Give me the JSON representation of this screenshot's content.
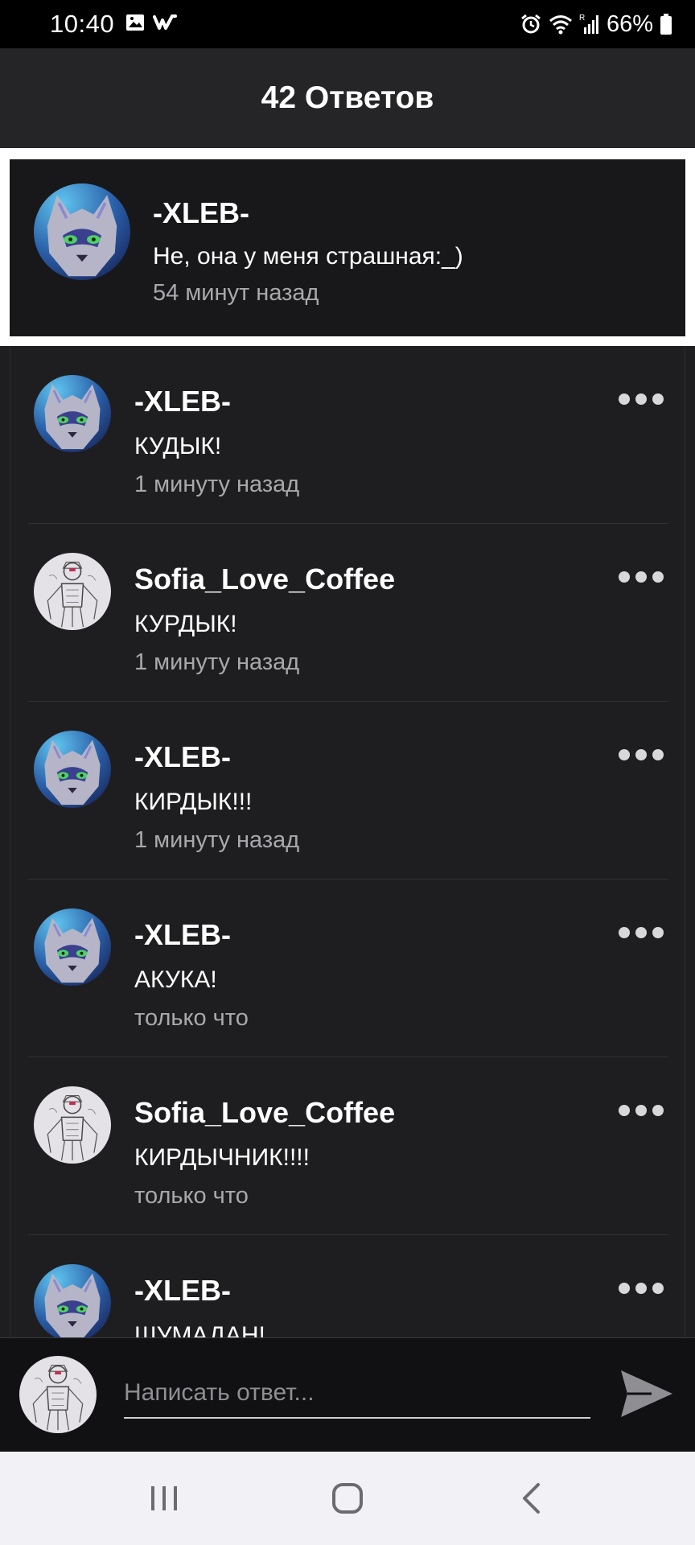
{
  "status_bar": {
    "time": "10:40",
    "battery": "66%",
    "left_icons": [
      "gallery-icon",
      "wattpad-icon"
    ],
    "right_icons": [
      "alarm-icon",
      "wifi-icon",
      "signal-icon",
      "battery-icon"
    ]
  },
  "header": {
    "title": "42 Ответов"
  },
  "parent_comment": {
    "author": "-XLEB-",
    "text": "Не, она у меня страшная:_)",
    "time": "54 минут назад",
    "avatar": "wolf-avatar"
  },
  "replies": [
    {
      "author": "-XLEB-",
      "text": "КУДЫК!",
      "time": "1 минуту назад",
      "avatar": "wolf-avatar"
    },
    {
      "author": "Sofia_Love_Coffee",
      "text": "КУРДЫК!",
      "time": "1 минуту назад",
      "avatar": "sketch-avatar"
    },
    {
      "author": "-XLEB-",
      "text": "КИРДЫК!!!",
      "time": "1 минуту назад",
      "avatar": "wolf-avatar"
    },
    {
      "author": "-XLEB-",
      "text": "АКУКА!",
      "time": "только что",
      "avatar": "wolf-avatar"
    },
    {
      "author": "Sofia_Love_Coffee",
      "text": "КИРДЫЧНИК!!!!",
      "time": "только что",
      "avatar": "sketch-avatar"
    },
    {
      "author": "-XLEB-",
      "text": "ШУМАДАН!",
      "time": "",
      "avatar": "wolf-avatar"
    }
  ],
  "composer": {
    "placeholder": "Написать ответ...",
    "avatar": "sketch-avatar",
    "send_icon": "send-icon"
  },
  "nav": {
    "icons": [
      "recents-icon",
      "home-icon",
      "back-icon"
    ]
  },
  "colors": {
    "background": "#1e1e20",
    "header": "#252527",
    "highlight_border": "#ffffff",
    "secondary_text": "#a9a9ad",
    "nav_bar": "#f2f1f6"
  }
}
